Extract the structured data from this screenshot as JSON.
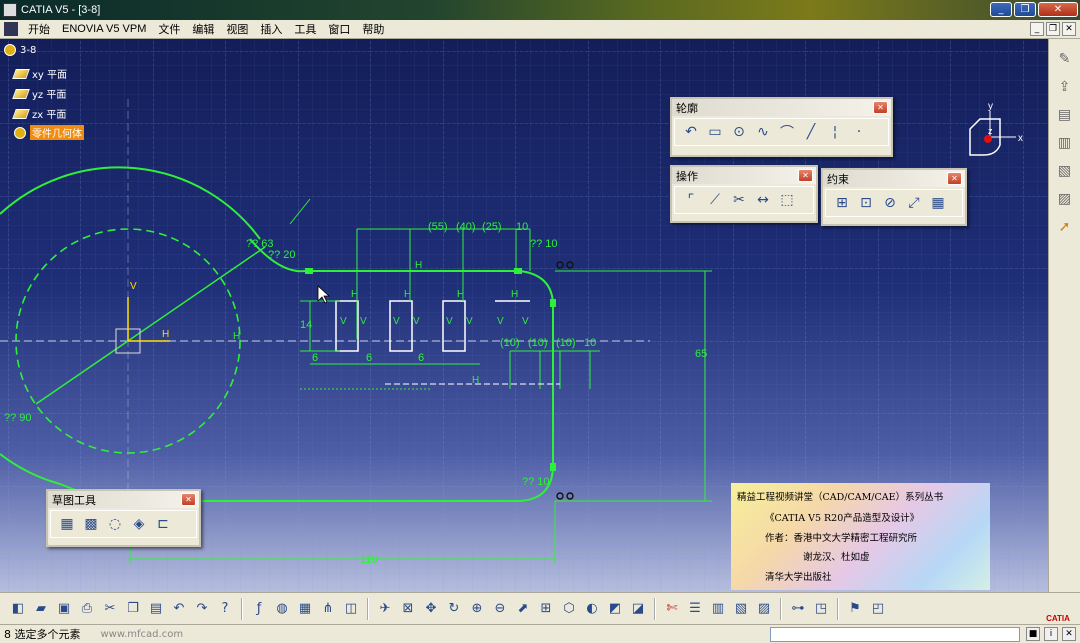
{
  "window": {
    "title": "CATIA V5 - [3-8]",
    "buttons": {
      "minimize": "_",
      "restore": "❐",
      "close": "✕"
    }
  },
  "menu": {
    "items": [
      "开始",
      "ENOVIA V5 VPM",
      "文件",
      "编辑",
      "视图",
      "插入",
      "工具",
      "窗口",
      "帮助"
    ]
  },
  "tree": {
    "root": "3-8",
    "nodes": [
      "xy 平面",
      "yz 平面",
      "zx 平面",
      "零件几何体"
    ]
  },
  "toolbars": {
    "profile": {
      "title": "轮廓"
    },
    "operation": {
      "title": "操作"
    },
    "constraint": {
      "title": "约束"
    },
    "sketch_tools": {
      "title": "草图工具"
    }
  },
  "compass": {
    "x": "x",
    "y": "y",
    "z": "z"
  },
  "dimensions": {
    "d55": "(55)",
    "d40": "(40)",
    "d25": "(25)",
    "d10a": "10",
    "d10b": "?? 10",
    "d20": "?? 20",
    "d63": "?? 63",
    "d90": "?? 90",
    "d14": "14",
    "d6a": "6",
    "d6b": "6",
    "d6c": "6",
    "d10c": "(10)",
    "d10d": "(10)",
    "d10e": "(10)",
    "d10f": "10",
    "d65": "65",
    "d110": "110",
    "d10g": "?? 10"
  },
  "constraint_marks": {
    "h": "H",
    "v": "V"
  },
  "watermark": {
    "line1": "精益工程视频讲堂（CAD/CAM/CAE）系列丛书",
    "line2": "《CATIA V5 R20产品造型及设计》",
    "line3": "作者：香港中文大学精密工程研究所",
    "line4": "谢龙汉、杜如虚",
    "line5": "清华大学出版社"
  },
  "status": {
    "message": "8 选定多个元素",
    "watermark_url": "www.mfcad.com"
  },
  "logo": "CATIA",
  "colors": {
    "sketch_green": "#2ef03a",
    "background_top": "#131e59",
    "selected_node": "#f08c10"
  }
}
